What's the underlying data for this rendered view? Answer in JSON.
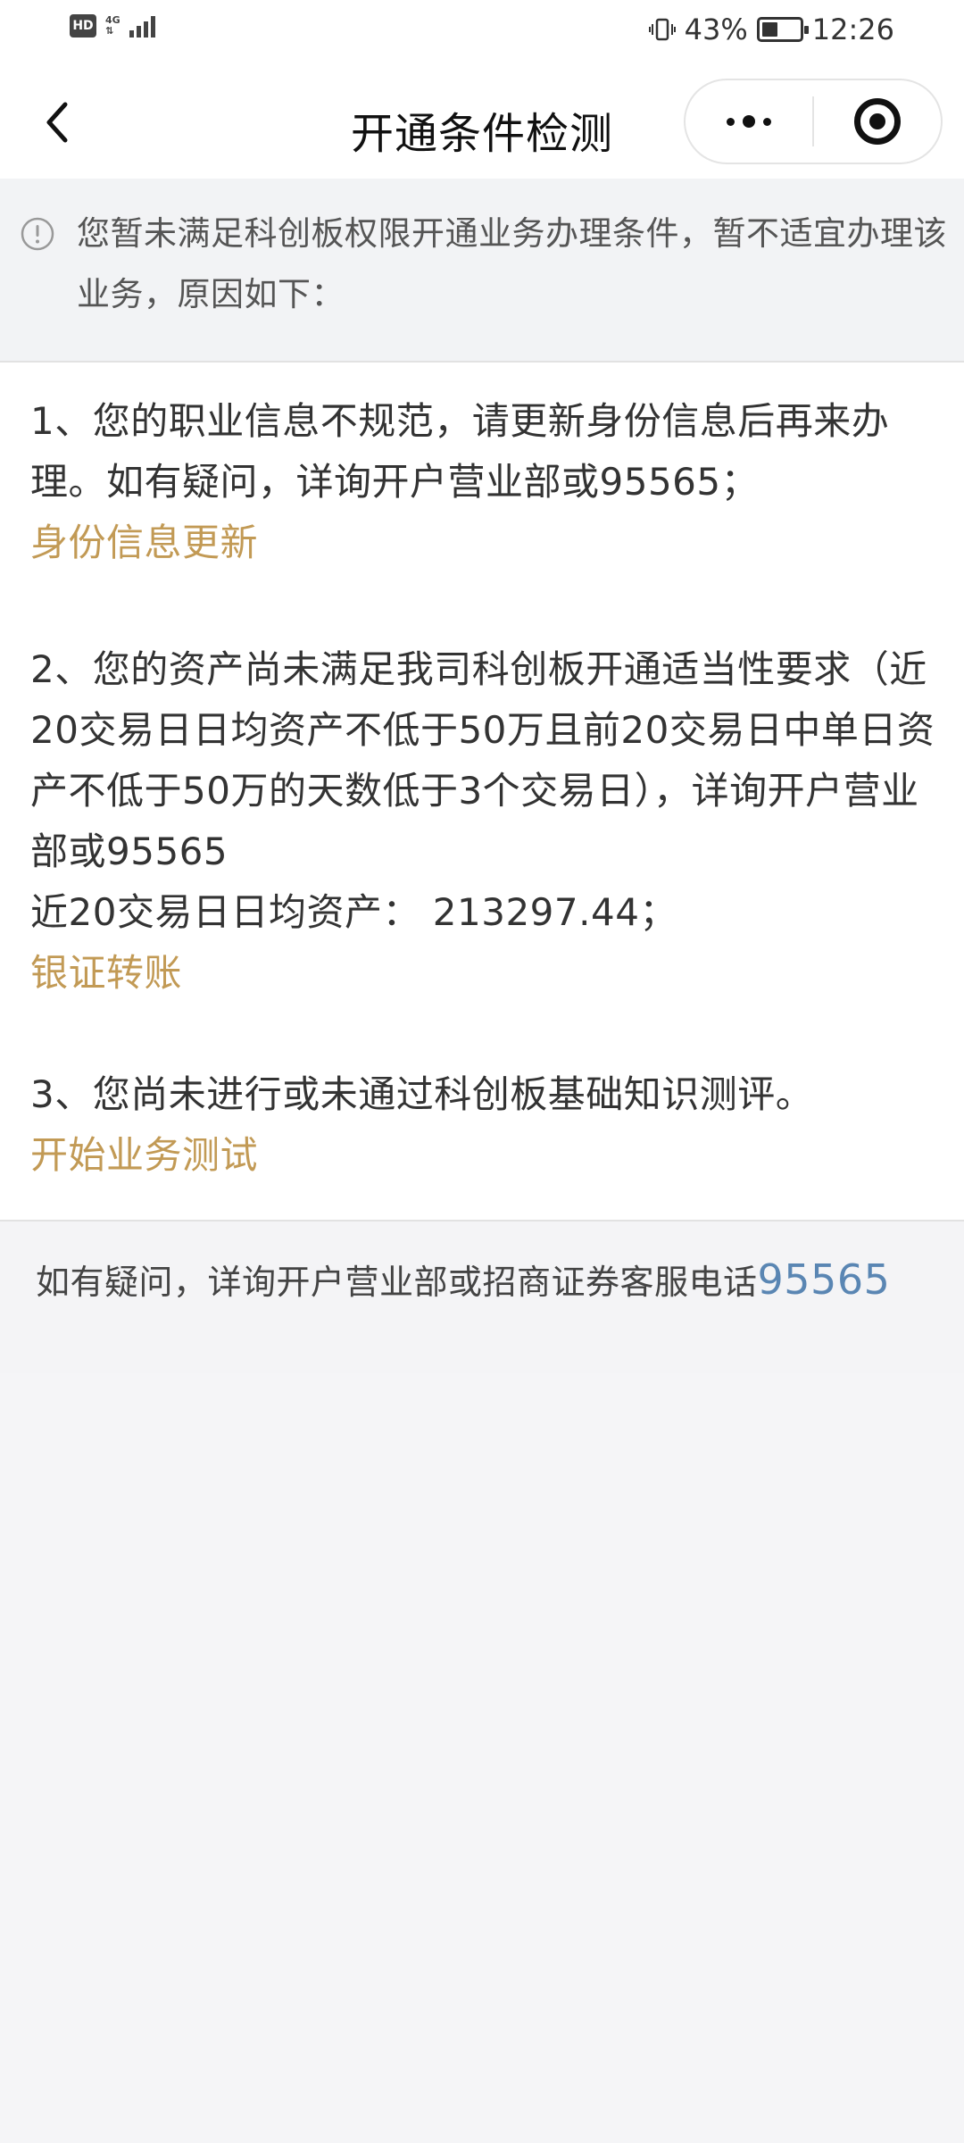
{
  "status_bar": {
    "hd_label": "HD",
    "network_label": "4G",
    "battery_percent": "43%",
    "battery_level": 0.43,
    "time": "12:26"
  },
  "nav": {
    "title": "开通条件检测"
  },
  "notice": {
    "text": "您暂未满足科创板权限开通业务办理条件，暂不适宜办理该业务，原因如下："
  },
  "reasons": {
    "item1": {
      "text": "1、您的职业信息不规范，请更新身份信息后再来办理。如有疑问，详询开户营业部或95565；",
      "link": "身份信息更新"
    },
    "item2": {
      "text": "2、您的资产尚未满足我司科创板开通适当性要求（近20交易日日均资产不低于50万且前20交易日中单日资产不低于50万的天数低于3个交易日），详询开户营业部或95565",
      "asset_line": "近20交易日日均资产： 213297.44；",
      "link": "银证转账"
    },
    "item3": {
      "text": "3、您尚未进行或未通过科创板基础知识测评。",
      "link": "开始业务测试"
    }
  },
  "footer": {
    "text": "如有疑问，详询开户营业部或招商证券客服电话",
    "phone": "95565"
  },
  "colors": {
    "link": "#c29a55",
    "phone": "#5a86b3",
    "background": "#f5f5f7"
  }
}
